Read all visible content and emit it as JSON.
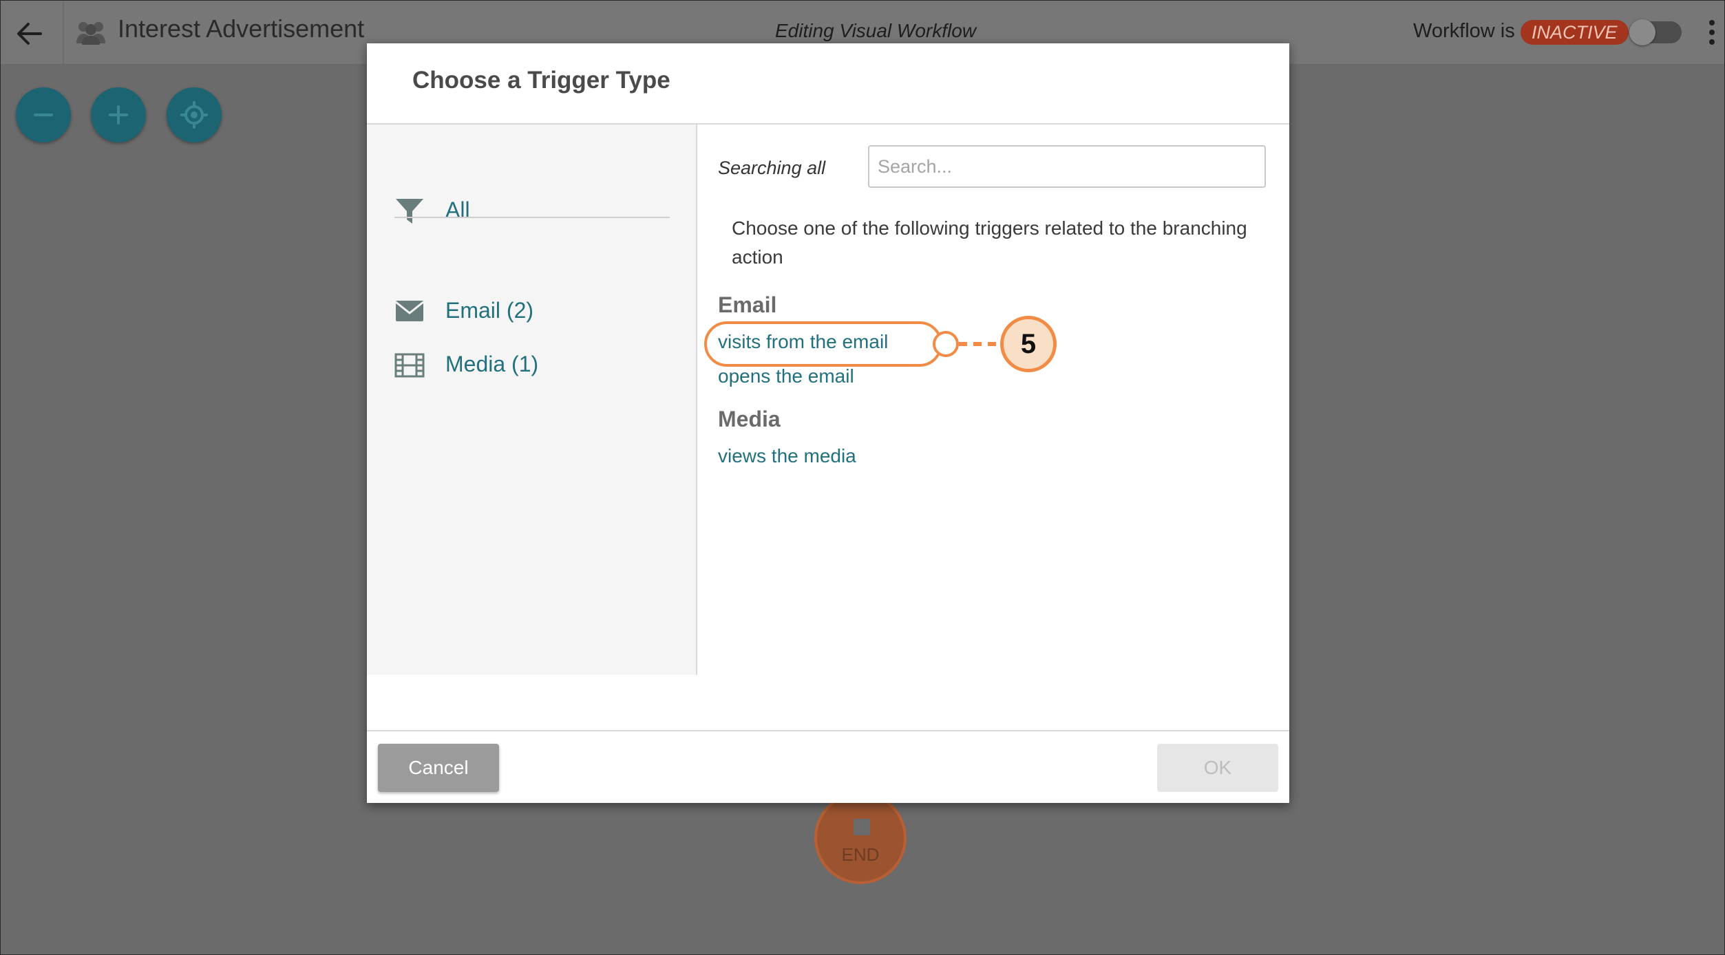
{
  "app": {
    "title": "Interest Advertisement",
    "editing_label": "Editing Visual Workflow",
    "status_label": "Workflow is",
    "status_badge": "INACTIVE"
  },
  "canvas": {
    "end_node_label": "END"
  },
  "modal": {
    "title": "Choose a Trigger Type",
    "categories": [
      {
        "label": "All",
        "icon": "filter-icon"
      },
      {
        "label": "Email (2)",
        "icon": "envelope-icon"
      },
      {
        "label": "Media (1)",
        "icon": "film-icon"
      }
    ],
    "search": {
      "label": "Searching all",
      "placeholder": "Search...",
      "value": ""
    },
    "instructions": "Choose one of the following triggers related to the branching action",
    "groups": [
      {
        "title": "Email",
        "triggers": [
          "visits from the email",
          "opens the email"
        ]
      },
      {
        "title": "Media",
        "triggers": [
          "views the media"
        ]
      }
    ],
    "step_badge": "5",
    "cancel_label": "Cancel",
    "ok_label": "OK"
  },
  "colors": {
    "accent": "#22707d",
    "highlight": "#f18b45",
    "inactive_badge": "#a3341e"
  }
}
